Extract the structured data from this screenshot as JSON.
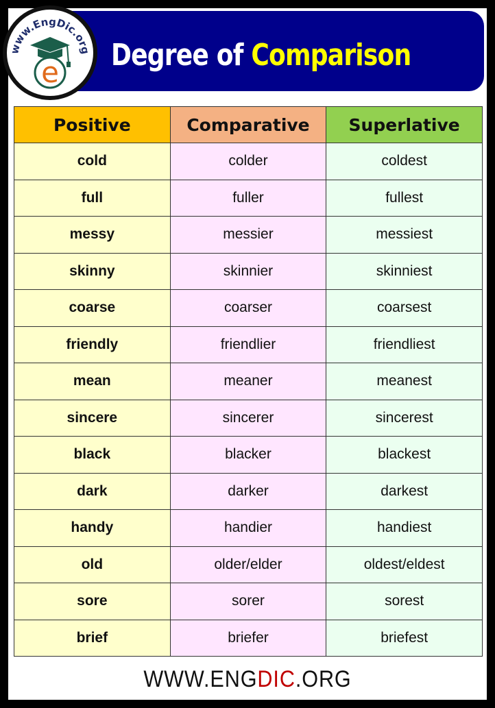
{
  "header": {
    "title_part1": "Degree of",
    "title_part2": "Comparison",
    "logo_text": "www.EngDic.org",
    "logo_letter": "e"
  },
  "colors": {
    "banner": "#00008b",
    "title_white": "#ffffff",
    "title_yellow": "#ffff00",
    "positive_header": "#ffc000",
    "comparative_header": "#f4b183",
    "superlative_header": "#92d050",
    "positive_cell": "#ffffcc",
    "comparative_cell": "#ffe6ff",
    "superlative_cell": "#ebfff0",
    "footer_accent": "#c00000"
  },
  "table": {
    "headers": [
      "Positive",
      "Comparative",
      "Superlative"
    ],
    "rows": [
      [
        "cold",
        "colder",
        "coldest"
      ],
      [
        "full",
        "fuller",
        "fullest"
      ],
      [
        "messy",
        "messier",
        "messiest"
      ],
      [
        "skinny",
        "skinnier",
        "skinniest"
      ],
      [
        "coarse",
        "coarser",
        "coarsest"
      ],
      [
        "friendly",
        "friendlier",
        "friendliest"
      ],
      [
        "mean",
        "meaner",
        "meanest"
      ],
      [
        "sincere",
        "sincerer",
        "sincerest"
      ],
      [
        "black",
        "blacker",
        "blackest"
      ],
      [
        "dark",
        "darker",
        "darkest"
      ],
      [
        "handy",
        "handier",
        "handiest"
      ],
      [
        "old",
        "older/elder",
        "oldest/eldest"
      ],
      [
        "sore",
        "sorer",
        "sorest"
      ],
      [
        "brief",
        "briefer",
        "briefest"
      ]
    ]
  },
  "footer": {
    "part1": "WWW.ENG",
    "part2": "DIC",
    "part3": ".ORG"
  }
}
